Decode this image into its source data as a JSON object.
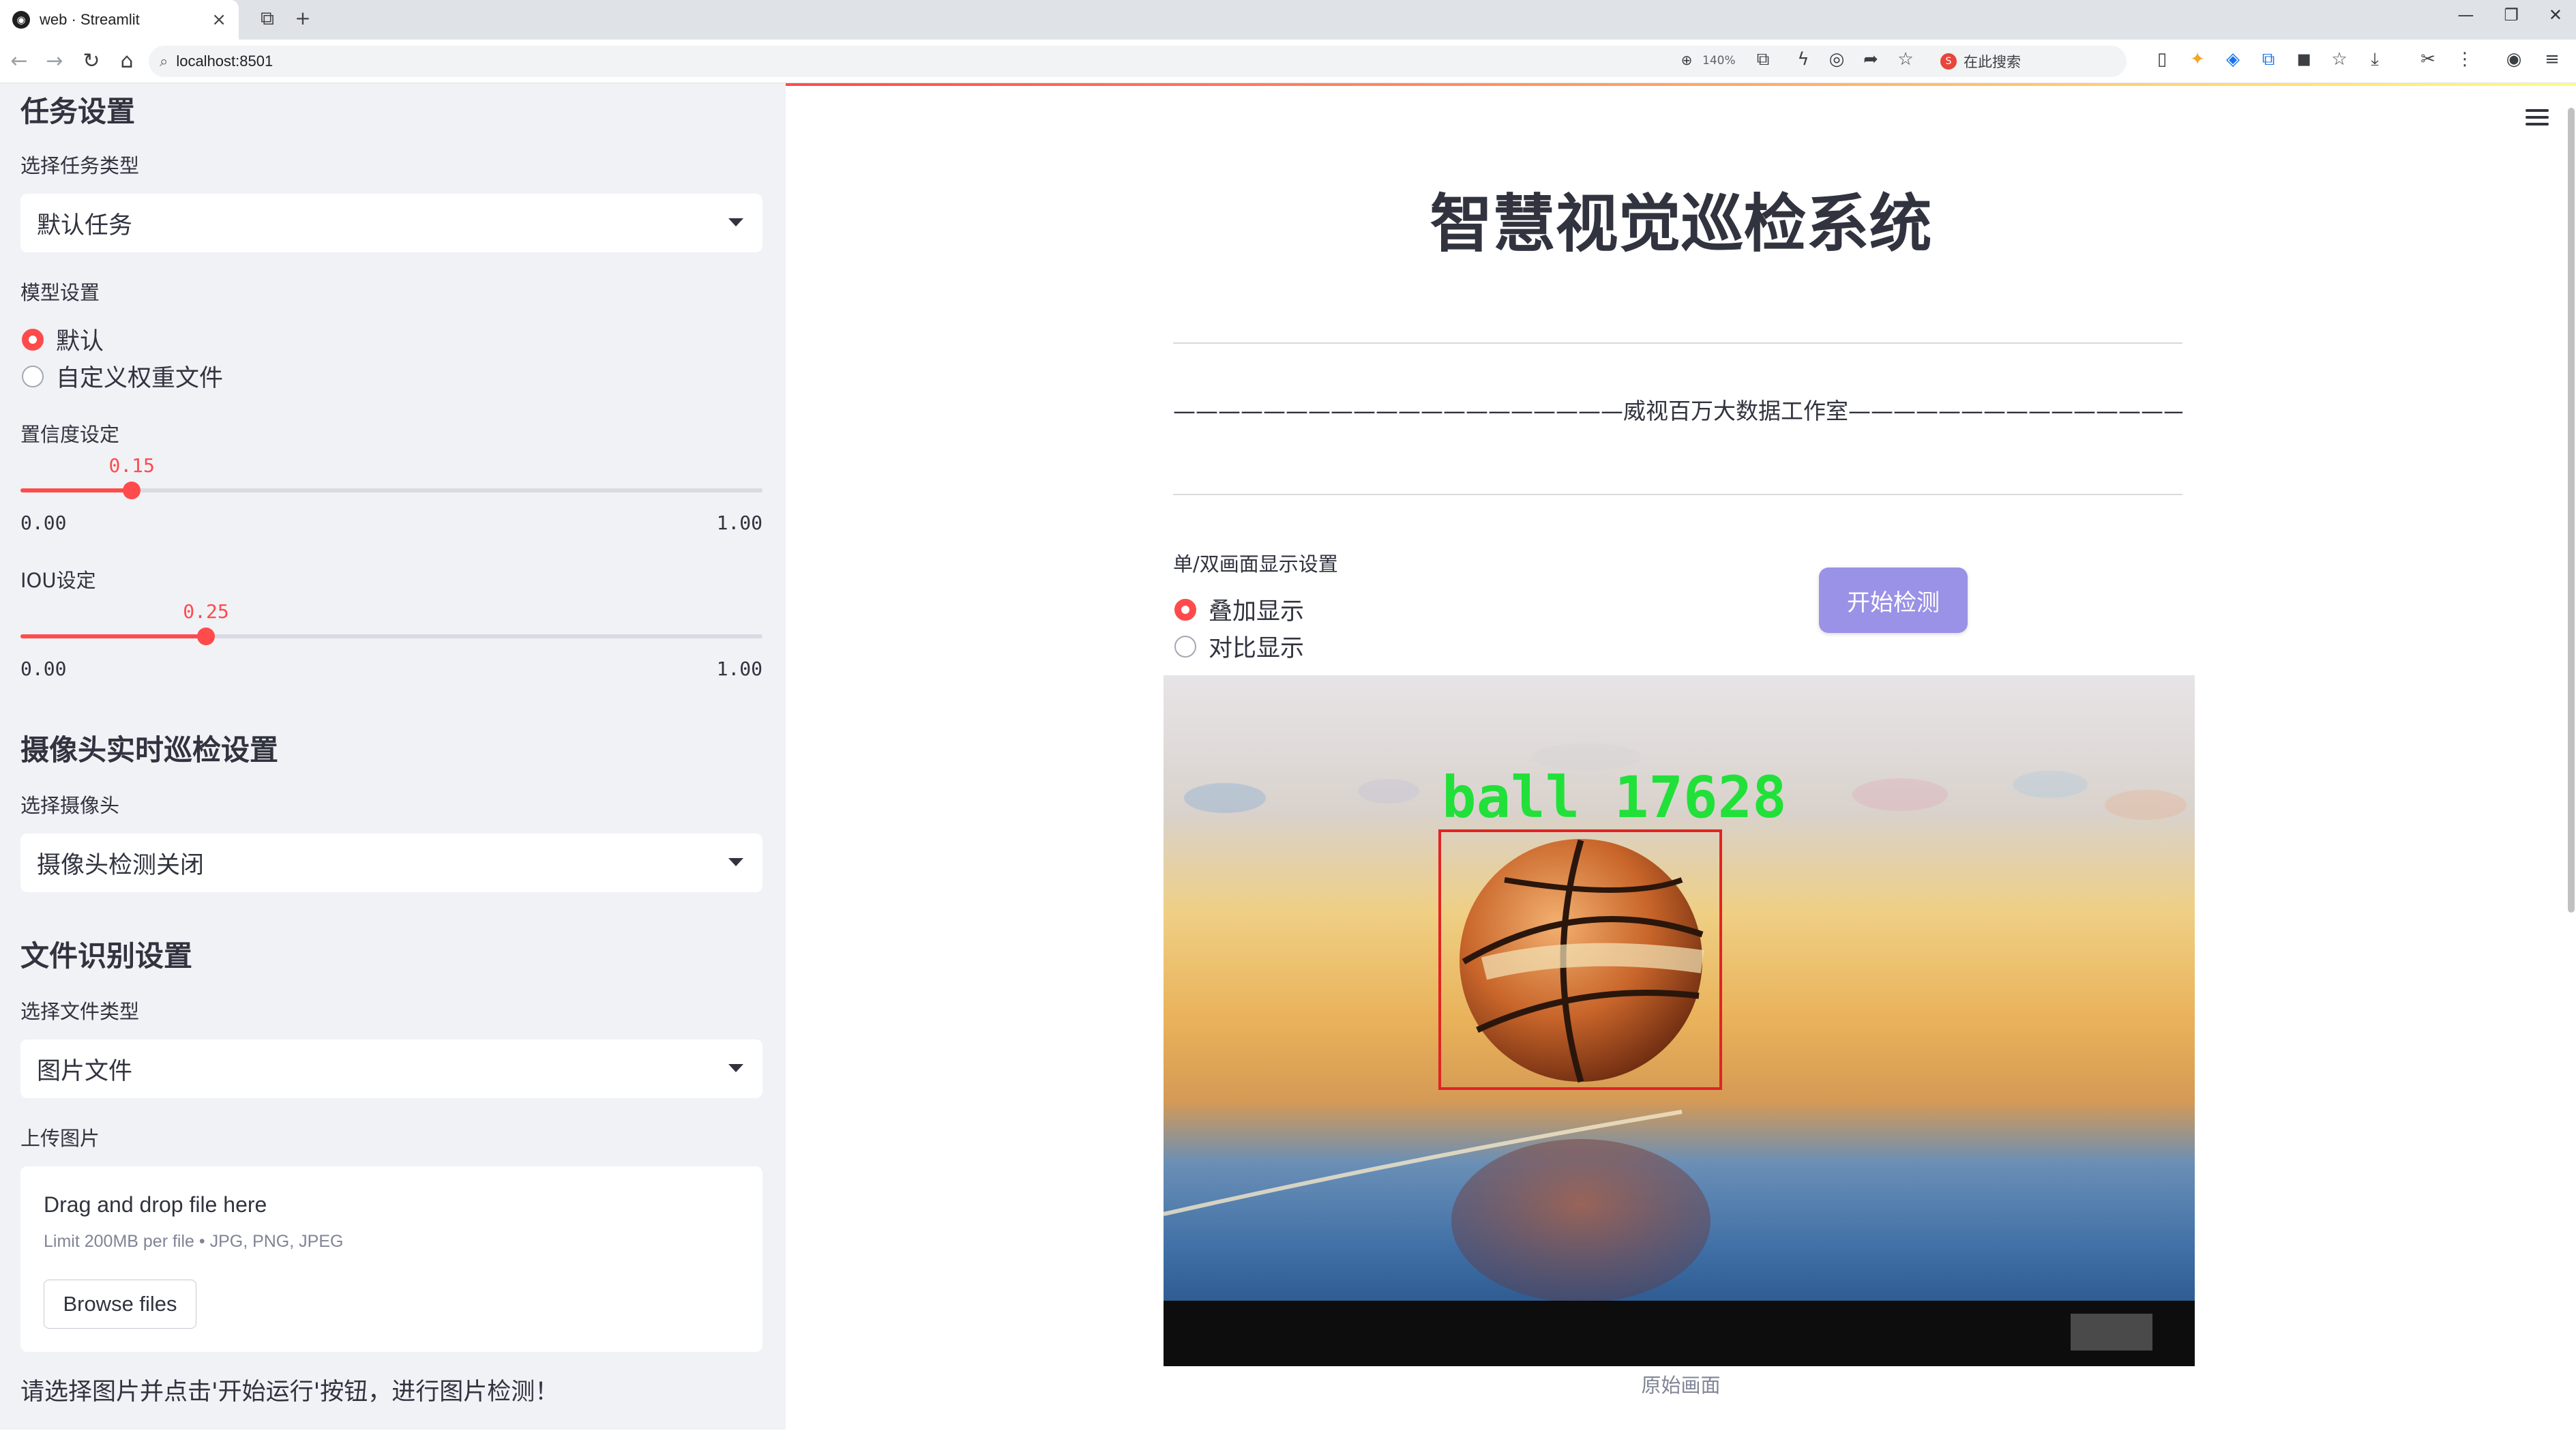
{
  "browser": {
    "tab_title": "web · Streamlit",
    "url": "localhost:8501",
    "zoom": "140%",
    "search_text": "在此搜索"
  },
  "sidebar": {
    "task_section": {
      "title": "任务设置",
      "task_type_label": "选择任务类型",
      "task_type_value": "默认任务"
    },
    "model_section": {
      "label": "模型设置",
      "options": [
        "默认",
        "自定义权重文件"
      ],
      "selected": "默认"
    },
    "confidence": {
      "label": "置信度设定",
      "value": "0.15",
      "value_fraction": 0.15,
      "min": "0.00",
      "max": "1.00"
    },
    "iou": {
      "label": "IOU设定",
      "value": "0.25",
      "value_fraction": 0.25,
      "min": "0.00",
      "max": "1.00"
    },
    "camera_section": {
      "title": "摄像头实时巡检设置",
      "label": "选择摄像头",
      "value": "摄像头检测关闭"
    },
    "file_section": {
      "title": "文件识别设置",
      "file_type_label": "选择文件类型",
      "file_type_value": "图片文件",
      "upload_label": "上传图片",
      "drag_text": "Drag and drop file here",
      "limit_text": "Limit 200MB per file • JPG, PNG, JPEG",
      "browse_label": "Browse files"
    },
    "hint": "请选择图片并点击'开始运行'按钮，进行图片检测！"
  },
  "main": {
    "title": "智慧视觉巡检系统",
    "studio_line": "————————————————————威视百万大数据工作室—————————————————————",
    "display_label": "单/双画面显示设置",
    "display_options": [
      "叠加显示",
      "对比显示"
    ],
    "display_selected": "叠加显示",
    "start_button": "开始检测",
    "detection_label": "ball 17628",
    "caption": "原始画面"
  },
  "colors": {
    "accent": "#ff4b4b",
    "sidebar_bg": "#f0f2f6",
    "start_button": "#9a92e6",
    "detection_text": "#22e03a",
    "detection_box": "#e02424"
  }
}
